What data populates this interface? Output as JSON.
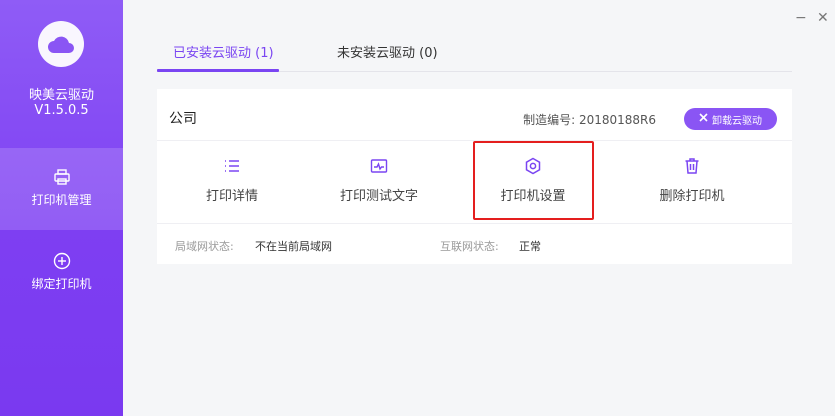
{
  "app": {
    "name": "映美云驱动",
    "version": "V1.5.0.5"
  },
  "sidebar": {
    "items": [
      {
        "label": "打印机管理",
        "icon": "printer-icon",
        "active": true
      },
      {
        "label": "绑定打印机",
        "icon": "plus-circle-icon",
        "active": false
      }
    ]
  },
  "window": {
    "minimize": "−",
    "close": "✕"
  },
  "tabs": [
    {
      "label": "已安装云驱动 (1)",
      "active": true
    },
    {
      "label": "未安装云驱动 (0)",
      "active": false
    }
  ],
  "printer": {
    "name": "公司",
    "serial_label": "制造编号:",
    "serial": "20180188R6",
    "uninstall_label": "卸载云驱动",
    "actions": [
      {
        "label": "打印详情",
        "icon": "list-icon"
      },
      {
        "label": "打印测试文字",
        "icon": "test-print-icon"
      },
      {
        "label": "打印机设置",
        "icon": "settings-gear-icon"
      },
      {
        "label": "删除打印机",
        "icon": "trash-icon"
      }
    ],
    "lan_status_label": "局域网状态:",
    "lan_status": "不在当前局域网",
    "internet_status_label": "互联网状态:",
    "internet_status": "正常"
  },
  "colors": {
    "accent": "#7a45f2",
    "highlight": "#e41e1e",
    "sidebar": "#8a50f5"
  }
}
